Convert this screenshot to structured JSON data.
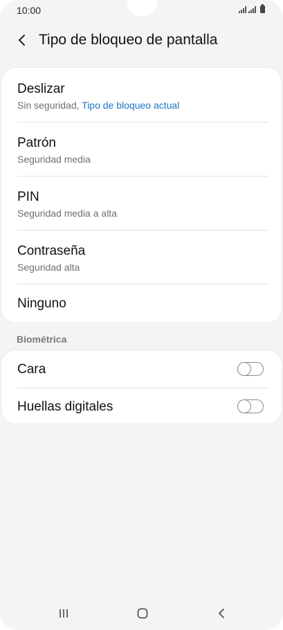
{
  "status": {
    "time": "10:00"
  },
  "header": {
    "title": "Tipo de bloqueo de pantalla"
  },
  "lock_types": [
    {
      "title": "Deslizar",
      "subtitle": "Sin seguridad,",
      "subtitle_link": "Tipo de bloqueo actual"
    },
    {
      "title": "Patrón",
      "subtitle": "Seguridad media"
    },
    {
      "title": "PIN",
      "subtitle": "Seguridad media a alta"
    },
    {
      "title": "Contraseña",
      "subtitle": "Seguridad alta"
    },
    {
      "title": "Ninguno"
    }
  ],
  "biometrics": {
    "section_label": "Biométrica",
    "items": [
      {
        "title": "Cara",
        "enabled": false
      },
      {
        "title": "Huellas digitales",
        "enabled": false
      }
    ]
  },
  "colors": {
    "accent_link": "#1a73c8",
    "background": "#f4f4f4"
  },
  "nav_icons": [
    "recent-apps-icon",
    "home-icon",
    "back-icon"
  ]
}
